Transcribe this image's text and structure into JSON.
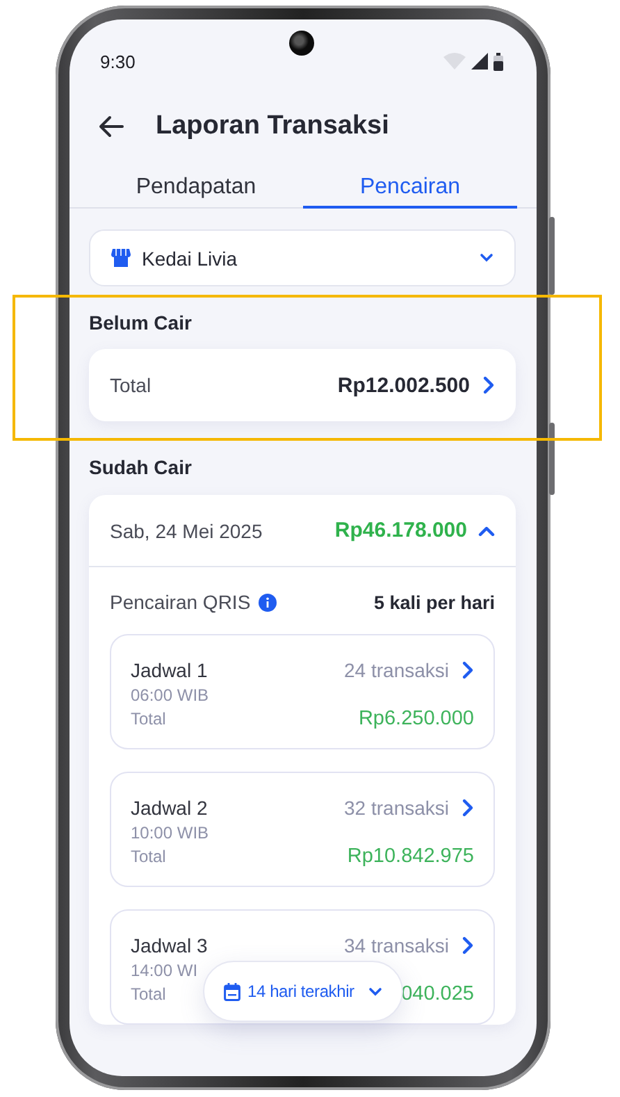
{
  "status_bar": {
    "time": "9:30"
  },
  "header": {
    "title": "Laporan Transaksi"
  },
  "tabs": [
    {
      "label": "Pendapatan",
      "selected": false
    },
    {
      "label": "Pencairan",
      "selected": true
    }
  ],
  "store_selector": {
    "value": "Kedai Livia"
  },
  "pending": {
    "title": "Belum Cair",
    "highlighted": true,
    "total_label": "Total",
    "total": "Rp12.002.500"
  },
  "paid": {
    "title": "Sudah Cair",
    "days": [
      {
        "date": "Sab, 24 Mei 2025",
        "amount": "Rp46.178.000",
        "expanded": true,
        "method": "Pencairan QRIS",
        "frequency": "5 kali per hari",
        "schedules": [
          {
            "name": "Jadwal 1",
            "time": "06:00 WIB",
            "transactions": "24 transaksi",
            "total_label": "Total",
            "total": "Rp6.250.000"
          },
          {
            "name": "Jadwal 2",
            "time": "10:00 WIB",
            "transactions": "32 transaksi",
            "total_label": "Total",
            "total": "Rp10.842.975"
          },
          {
            "name": "Jadwal 3",
            "time": "14:00 WI",
            "transactions": "34 transaksi",
            "total_label": "Total",
            "total": "040.025"
          }
        ]
      }
    ]
  },
  "date_filter": {
    "label": "14 hari terakhir"
  }
}
